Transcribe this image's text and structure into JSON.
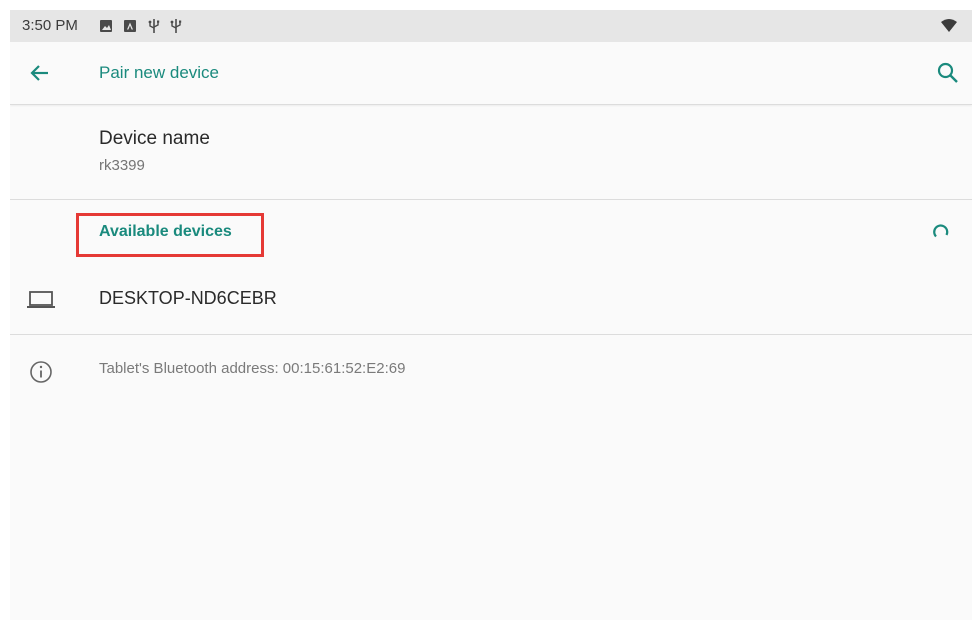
{
  "status_bar": {
    "time": "3:50 PM",
    "notification_icons": [
      "image-icon",
      "app-a-icon",
      "usb-icon",
      "usb-icon"
    ],
    "wifi_icon": "wifi-icon"
  },
  "app_bar": {
    "back_icon": "arrow-left-icon",
    "title": "Pair new device",
    "search_icon": "search-icon"
  },
  "device_name": {
    "title": "Device name",
    "value": "rk3399"
  },
  "available_devices": {
    "header": "Available devices",
    "scanning_icon": "progress-spinner-icon",
    "items": [
      {
        "icon": "laptop-icon",
        "name": "DESKTOP-ND6CEBR"
      }
    ]
  },
  "info": {
    "icon": "info-icon",
    "text": "Tablet's Bluetooth address: 00:15:61:52:E2:69"
  },
  "colors": {
    "accent": "#1a8a7d",
    "highlight": "#e53935",
    "status_bar_bg": "#e6e6e6",
    "background": "#fafafa"
  }
}
